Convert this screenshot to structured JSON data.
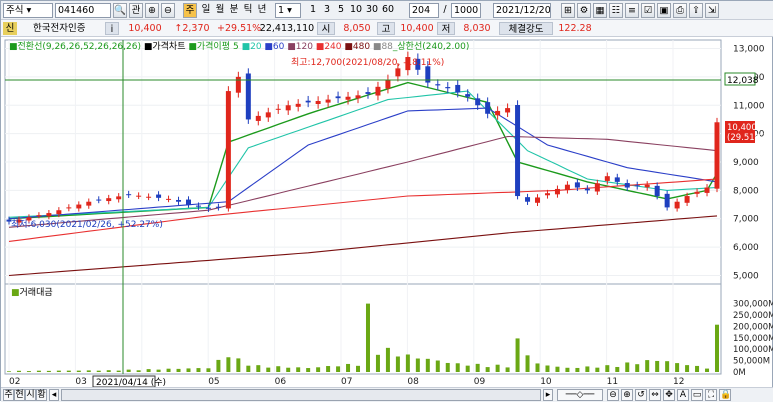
{
  "toolbar": {
    "market": "주식",
    "code": "041460",
    "rel_label": "관",
    "order_label": "주",
    "period_day": "일",
    "period_week": "월",
    "period_day2": "분",
    "period_tick": "틱",
    "period_year": "년",
    "interval": "1",
    "quick": [
      "1",
      "3",
      "5",
      "10",
      "30",
      "60"
    ],
    "count": "204",
    "slash": "/",
    "total": "1000",
    "date": "2021/12/20"
  },
  "infobar": {
    "tag": "신",
    "name": "한국전자인증",
    "info": "i",
    "price": "10,400",
    "change": "↑2,370",
    "rate": "+29.51%",
    "volume": "22,413,110",
    "open_label": "시",
    "open": "8,050",
    "high_label": "고",
    "high": "10,400",
    "low_label": "저",
    "low": "8,030",
    "strength_label": "체결강도",
    "strength": "122.28"
  },
  "legend": {
    "conv": "전환선(9,26,26,52,26,26,26)",
    "price": "가격차트",
    "ma": "가격이평",
    "ma5": "5",
    "ma20": "20",
    "ma60": "60",
    "ma120": "120",
    "ma240": "240",
    "ma480": "480",
    "ma88": "88",
    "upper": "상한선(240,2.00)"
  },
  "annotations": {
    "high": "최고:12,700(2021/08/20, -18.11%)",
    "low": "최저:6,030(2021/02/26, +52.27%)"
  },
  "crosshair_date": "2021/04/14 (수)",
  "volume_label": "거래대금",
  "last_price_tag": [
    "10,400",
    "(29.51%)"
  ],
  "line_tag": "12,038",
  "bottom": {
    "tabs": [
      "주",
      "현",
      "시",
      "황"
    ]
  },
  "colors": {
    "up": "#e0261c",
    "down": "#1e3fbf",
    "ma5": "#1c9a1c",
    "ma20": "#20c4a8",
    "ma60": "#2b3fc8",
    "ma120": "#8a4060",
    "ma240": "#e83030",
    "ma480": "#7a1010",
    "volume": "#6aa814"
  },
  "chart_data": {
    "type": "candlestick",
    "title": "",
    "x_tick_labels": [
      "02",
      "03",
      "04",
      "05",
      "06",
      "07",
      "08",
      "09",
      "10",
      "11",
      "12"
    ],
    "y_tick_labels": [
      "5,000",
      "6,000",
      "7,000",
      "8,000",
      "9,000",
      "10,000",
      "11,000",
      "12,000",
      "13,000"
    ],
    "ylim": [
      4700,
      13300
    ],
    "volume_tick_labels": [
      "0M",
      "50,000M",
      "100,000M",
      "150,000M",
      "200,000M",
      "250,000M",
      "300,000M"
    ],
    "volume_ylim": [
      0,
      320000
    ],
    "price_path": [
      [
        0,
        6900
      ],
      [
        4,
        7200
      ],
      [
        8,
        7600
      ],
      [
        12,
        7850
      ],
      [
        16,
        7700
      ],
      [
        18,
        7500
      ],
      [
        20,
        7350
      ],
      [
        21,
        7400
      ],
      [
        22,
        11500
      ],
      [
        23,
        12000
      ],
      [
        24,
        10500
      ],
      [
        28,
        11000
      ],
      [
        32,
        11200
      ],
      [
        36,
        11400
      ],
      [
        38,
        11900
      ],
      [
        40,
        12700
      ],
      [
        42,
        11800
      ],
      [
        44,
        11600
      ],
      [
        46,
        11300
      ],
      [
        48,
        10700
      ],
      [
        50,
        10900
      ],
      [
        51,
        7800
      ],
      [
        52,
        7600
      ],
      [
        54,
        7900
      ],
      [
        56,
        8200
      ],
      [
        58,
        8000
      ],
      [
        60,
        8500
      ],
      [
        62,
        8100
      ],
      [
        64,
        8200
      ],
      [
        66,
        7400
      ],
      [
        68,
        7800
      ],
      [
        70,
        8100
      ],
      [
        71,
        10400
      ]
    ],
    "volume_path": [
      [
        0,
        5
      ],
      [
        10,
        8
      ],
      [
        20,
        20
      ],
      [
        22,
        90
      ],
      [
        23,
        60
      ],
      [
        25,
        30
      ],
      [
        30,
        20
      ],
      [
        35,
        40
      ],
      [
        36,
        300
      ],
      [
        37,
        120
      ],
      [
        40,
        80
      ],
      [
        45,
        40
      ],
      [
        50,
        30
      ],
      [
        51,
        150
      ],
      [
        53,
        40
      ],
      [
        56,
        20
      ],
      [
        60,
        30
      ],
      [
        65,
        60
      ],
      [
        70,
        20
      ],
      [
        71,
        210
      ]
    ],
    "ma_lines": [
      {
        "name": "5",
        "points": [
          [
            0,
            7000
          ],
          [
            20,
            7400
          ],
          [
            22,
            9700
          ],
          [
            30,
            10700
          ],
          [
            40,
            11800
          ],
          [
            48,
            11100
          ],
          [
            51,
            9000
          ],
          [
            58,
            8300
          ],
          [
            66,
            7700
          ],
          [
            70,
            8000
          ],
          [
            71,
            8600
          ]
        ]
      },
      {
        "name": "20",
        "points": [
          [
            0,
            7050
          ],
          [
            20,
            7400
          ],
          [
            24,
            9500
          ],
          [
            38,
            11200
          ],
          [
            46,
            11500
          ],
          [
            52,
            9400
          ],
          [
            58,
            8400
          ],
          [
            66,
            8000
          ],
          [
            71,
            8100
          ]
        ]
      },
      {
        "name": "60",
        "points": [
          [
            0,
            7000
          ],
          [
            22,
            7600
          ],
          [
            30,
            9600
          ],
          [
            40,
            10800
          ],
          [
            48,
            10900
          ],
          [
            54,
            9600
          ],
          [
            62,
            8800
          ],
          [
            71,
            8300
          ]
        ]
      },
      {
        "name": "120",
        "points": [
          [
            0,
            6700
          ],
          [
            20,
            7300
          ],
          [
            40,
            9000
          ],
          [
            50,
            9900
          ],
          [
            60,
            9800
          ],
          [
            71,
            9400
          ]
        ]
      },
      {
        "name": "240",
        "points": [
          [
            0,
            6200
          ],
          [
            20,
            7100
          ],
          [
            40,
            7800
          ],
          [
            55,
            8000
          ],
          [
            71,
            8400
          ]
        ]
      },
      {
        "name": "480",
        "points": [
          [
            0,
            5000
          ],
          [
            30,
            5800
          ],
          [
            50,
            6500
          ],
          [
            71,
            7100
          ]
        ]
      }
    ]
  }
}
